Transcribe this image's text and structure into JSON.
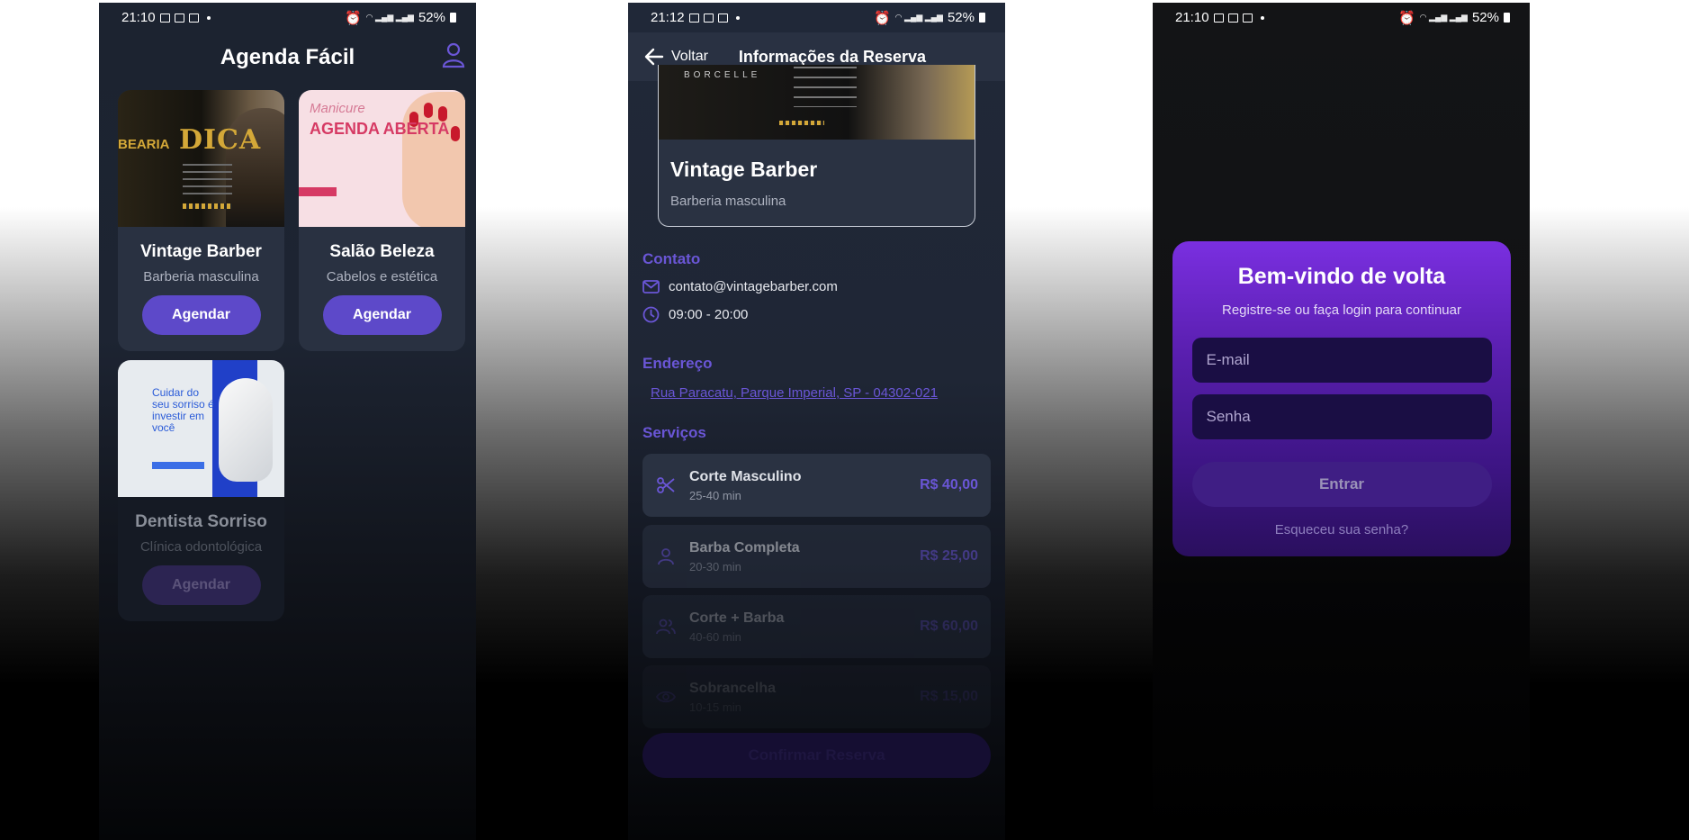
{
  "phones": [
    {
      "status": {
        "time": "21:10",
        "battery": "52%"
      }
    },
    {
      "status": {
        "time": "21:12",
        "battery": "52%"
      }
    },
    {
      "status": {
        "time": "21:10",
        "battery": "52%"
      }
    }
  ],
  "home": {
    "title": "Agenda Fácil",
    "cards": [
      {
        "name": "Vintage Barber",
        "category": "Barberia masculina",
        "button": "Agendar",
        "image_text": "DICA",
        "image_side": "BEARIA"
      },
      {
        "name": "Salão Beleza",
        "category": "Cabelos e estética",
        "button": "Agendar",
        "image_script": "Manicure",
        "image_big": "AGENDA ABERTA"
      },
      {
        "name": "Dentista Sorriso",
        "category": "Clínica odontológica",
        "button": "Agendar",
        "image_text": "Cuidar do seu sorriso é investir em você"
      }
    ]
  },
  "details": {
    "back_label": "Voltar",
    "title": "Informações da Reserva",
    "brand": "BORCELLE",
    "business_name": "Vintage Barber",
    "business_category": "Barberia masculina",
    "contact_title": "Contato",
    "email": "contato@vintagebarber.com",
    "hours": "09:00 - 20:00",
    "address_title": "Endereço",
    "address": "Rua Paracatu, Parque Imperial, SP - 04302-021",
    "services_title": "Serviços",
    "services": [
      {
        "name": "Corte Masculino",
        "duration": "25-40 min",
        "price": "R$ 40,00",
        "icon": "scissors-icon"
      },
      {
        "name": "Barba Completa",
        "duration": "20-30 min",
        "price": "R$ 25,00",
        "icon": "person-icon"
      },
      {
        "name": "Corte + Barba",
        "duration": "40-60 min",
        "price": "R$ 60,00",
        "icon": "people-icon"
      },
      {
        "name": "Sobrancelha",
        "duration": "10-15 min",
        "price": "R$ 15,00",
        "icon": "eye-icon"
      }
    ],
    "confirm_button": "Confirmar Reserva"
  },
  "login": {
    "title": "Bem-vindo de volta",
    "subtitle": "Registre-se ou faça login para continuar",
    "email_placeholder": "E-mail",
    "password_placeholder": "Senha",
    "submit": "Entrar",
    "forgot": "Esqueceu sua senha?"
  },
  "colors": {
    "accent": "#5d49c9",
    "accent_text": "#6a56d6",
    "card_bg": "#293141",
    "login_gradient_top": "#7a2fe0"
  }
}
